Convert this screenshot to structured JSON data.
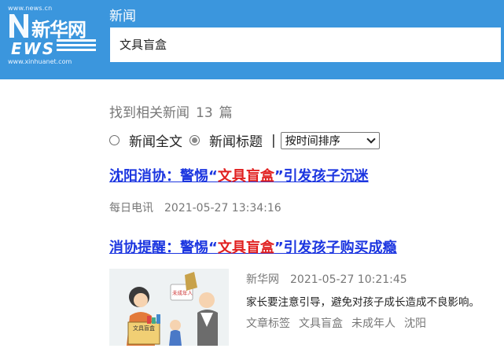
{
  "header": {
    "logo": {
      "url_top": "www.news.cn",
      "name": "新华网",
      "ews": "EWS",
      "url_bottom": "www.xinhuanet.com"
    },
    "channel": "新闻",
    "search_value": "文具盲盒",
    "accent_color": "#3b96dd"
  },
  "summary": {
    "prefix": "找到相关新闻",
    "count": "13",
    "suffix": "篇"
  },
  "filters": {
    "options": [
      {
        "label": "新闻全文",
        "checked": false
      },
      {
        "label": "新闻标题",
        "checked": true
      }
    ],
    "separator": "|",
    "sort_selected": "按时间排序"
  },
  "results": [
    {
      "title_before": "沈阳消协：警惕“",
      "title_highlight": "文具盲盒",
      "title_after": "”引发孩子沉迷",
      "source": "每日电讯",
      "date": "2021-05-27 13:34:16"
    },
    {
      "title_before": "消协提醒：警惕“",
      "title_highlight": "文具盲盒",
      "title_after": "”引发孩子购买成瘾",
      "source": "新华网",
      "date": "2021-05-27 10:21:45",
      "description": "家长要注意引导，避免对孩子成长造成不良影响。",
      "tags_label": "文章标签",
      "tags": [
        "文具盲盒",
        "未成年人",
        "沈阳"
      ],
      "thumbnail": {
        "box_text": "文具盲盒",
        "bubble_text": "未成年人"
      }
    }
  ],
  "colors": {
    "link": "#1c36e0",
    "highlight": "#e12020",
    "muted": "#777777"
  }
}
